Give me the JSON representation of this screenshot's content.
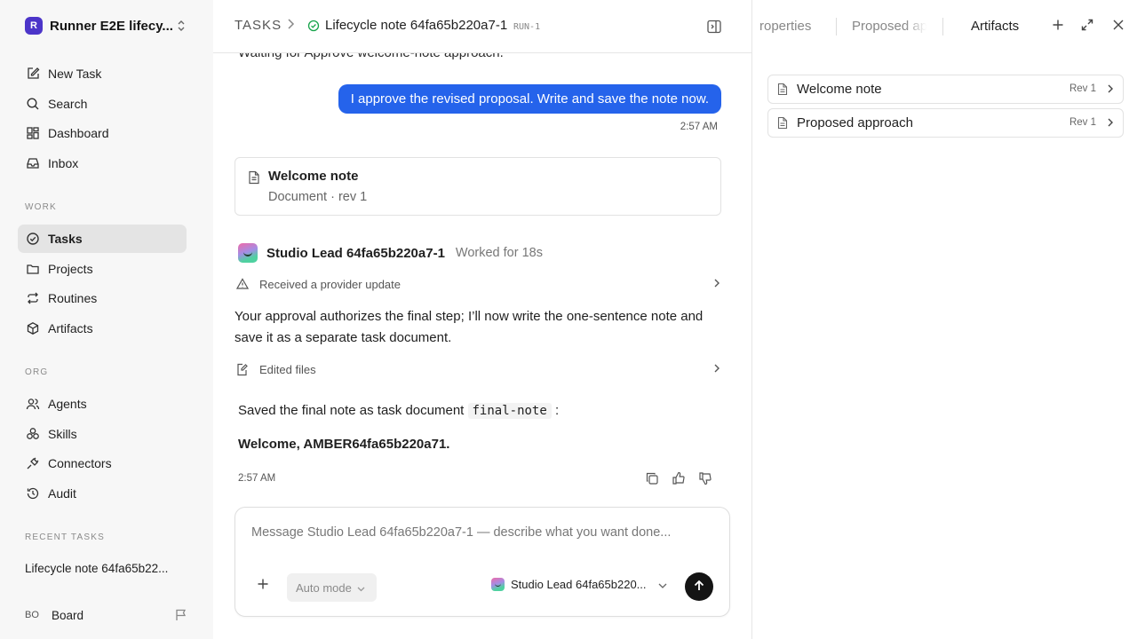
{
  "workspace": {
    "logo_letter": "R",
    "name": "Runner E2E lifecy..."
  },
  "nav": {
    "new_task": "New Task",
    "search": "Search",
    "dashboard": "Dashboard",
    "inbox": "Inbox",
    "work_label": "WORK",
    "tasks": "Tasks",
    "projects": "Projects",
    "routines": "Routines",
    "artifacts": "Artifacts",
    "org_label": "ORG",
    "agents": "Agents",
    "skills": "Skills",
    "connectors": "Connectors",
    "audit": "Audit",
    "recent_label": "RECENT TASKS",
    "recent_item": "Lifecycle note 64fa65b22..."
  },
  "user": {
    "initials": "BO",
    "name": "Board"
  },
  "header": {
    "crumb": "TASKS",
    "title": "Lifecycle note 64fa65b220a7-1",
    "run": "RUN-1"
  },
  "thread": {
    "waiting": "Waiting for Approve welcome-note approach.",
    "user_message": "I approve the revised proposal. Write and save the note now.",
    "user_time": "2:57 AM",
    "doc_card": {
      "title": "Welcome note",
      "subtitle": "Document · rev 1"
    },
    "agent_name": "Studio Lead 64fa65b220a7-1",
    "agent_worked": "Worked for 18s",
    "step_update": "Received a provider update",
    "paragraph": "Your approval authorizes the final step; I’ll now write the one-sentence note and save it as a separate task document.",
    "step_edited": "Edited files",
    "saved_prefix": "Saved the final note as task document",
    "saved_code": "final-note",
    "saved_suffix": ":",
    "welcome_text": "Welcome, AMBER64fa65b220a71.",
    "agent_time": "2:57 AM"
  },
  "composer": {
    "placeholder": "Message Studio Lead 64fa65b220a7-1 — describe what you want done...",
    "mode": "Auto mode",
    "agent": "Studio Lead 64fa65b220..."
  },
  "right_panel": {
    "tabs": [
      "roperties",
      "Proposed ap",
      "Artifacts"
    ],
    "artifacts": [
      {
        "title": "Welcome note",
        "rev": "Rev 1"
      },
      {
        "title": "Proposed approach",
        "rev": "Rev 1"
      }
    ]
  },
  "colors": {
    "accent": "#2563eb",
    "logo": "#4c35c9",
    "send": "#141414"
  }
}
